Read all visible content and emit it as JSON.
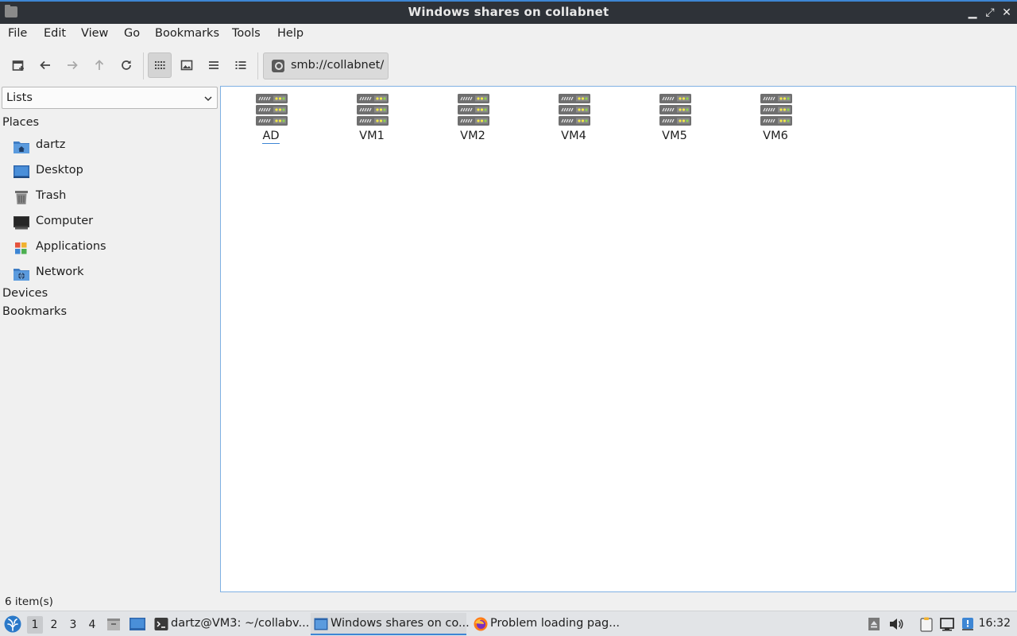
{
  "window": {
    "title": "Windows shares on collabnet",
    "minimize_glyph": "▁",
    "maximize_glyph": "⤢",
    "close_glyph": "✕"
  },
  "menu": [
    "File",
    "Edit",
    "View",
    "Go",
    "Bookmarks",
    "Tools",
    "Help"
  ],
  "toolbar": {
    "buttons": [
      {
        "name": "new-tab-icon"
      },
      {
        "name": "back-icon"
      },
      {
        "name": "forward-icon"
      },
      {
        "name": "up-icon"
      },
      {
        "name": "reload-icon"
      },
      {
        "name": "icon-view-icon",
        "active": true
      },
      {
        "name": "thumbnail-view-icon"
      },
      {
        "name": "compact-view-icon"
      },
      {
        "name": "detailed-list-view-icon"
      }
    ],
    "path": "smb://collabnet/"
  },
  "sidebar": {
    "mode": "Lists",
    "places_header": "Places",
    "places": [
      {
        "label": "dartz",
        "icon": "home-folder-icon"
      },
      {
        "label": "Desktop",
        "icon": "desktop-icon"
      },
      {
        "label": "Trash",
        "icon": "trash-icon"
      },
      {
        "label": "Computer",
        "icon": "computer-icon"
      },
      {
        "label": "Applications",
        "icon": "applications-icon"
      },
      {
        "label": "Network",
        "icon": "network-folder-icon"
      }
    ],
    "devices_header": "Devices",
    "bookmarks_header": "Bookmarks"
  },
  "files": [
    {
      "label": "AD",
      "focused": true
    },
    {
      "label": "VM1"
    },
    {
      "label": "VM2"
    },
    {
      "label": "VM4"
    },
    {
      "label": "VM5"
    },
    {
      "label": "VM6"
    }
  ],
  "status": {
    "items": "6 item(s)"
  },
  "taskbar": {
    "workspaces": [
      "1",
      "2",
      "3",
      "4"
    ],
    "active_workspace": "1",
    "tasks": [
      {
        "label": "dartz@VM3: ~/collabv...",
        "icon": "terminal-icon"
      },
      {
        "label": "Windows shares on co...",
        "icon": "file-manager-icon",
        "active": true
      },
      {
        "label": "Problem loading pag...",
        "icon": "firefox-icon"
      }
    ],
    "clock": "16:32"
  }
}
